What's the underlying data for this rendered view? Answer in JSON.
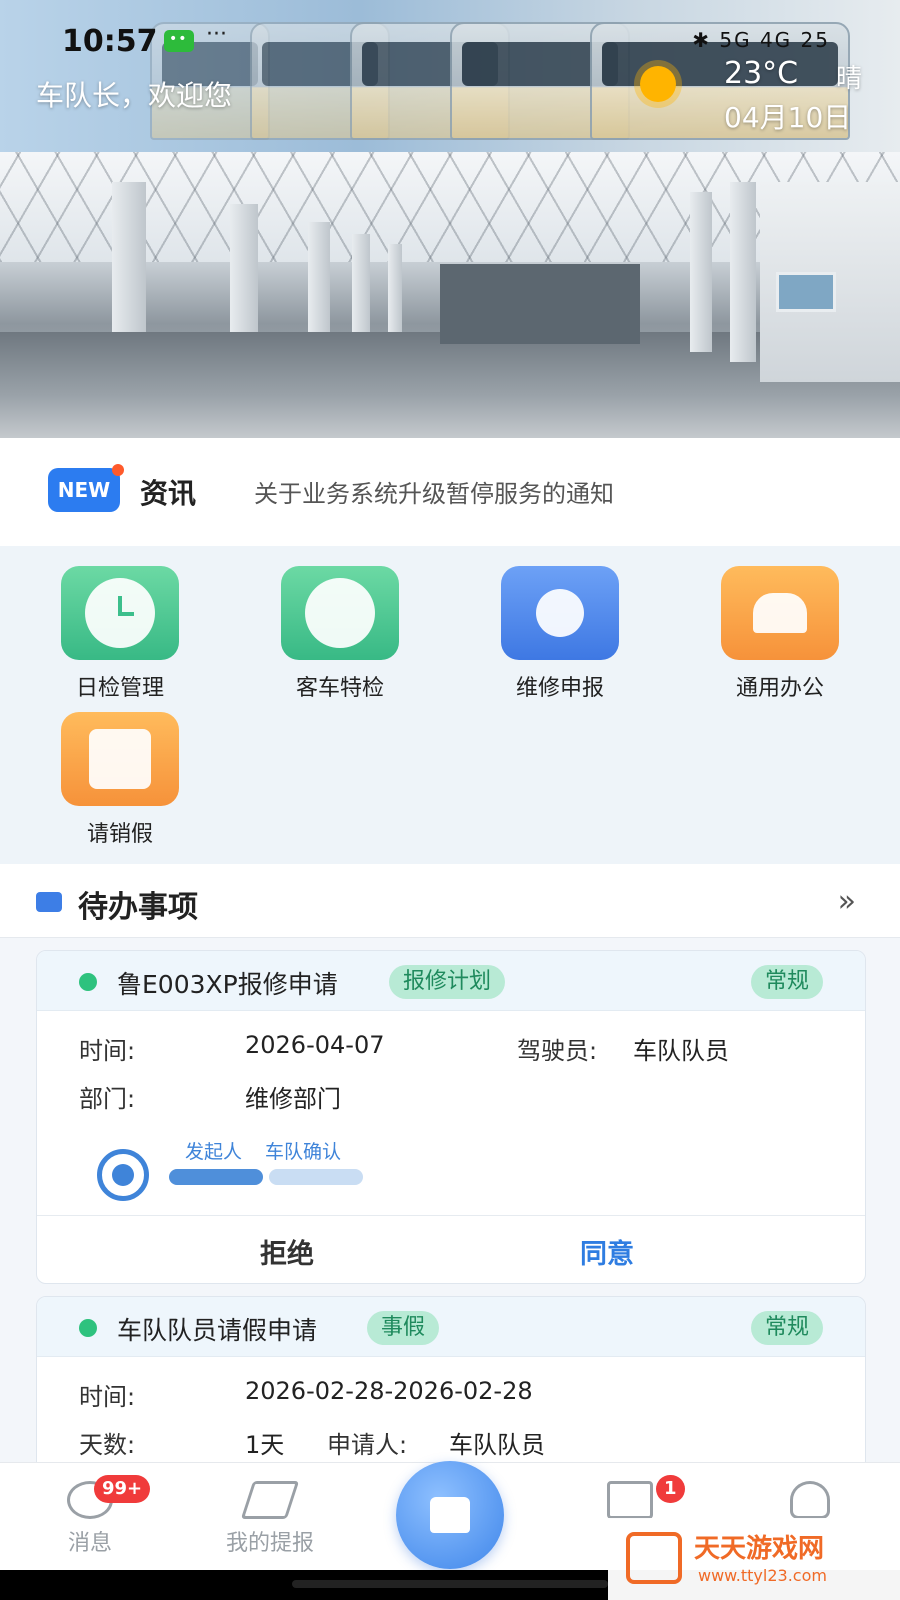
{
  "status_bar": {
    "time": "10:57",
    "more": "···",
    "icons_text": "✱ 5G 4G 25"
  },
  "header": {
    "welcome": "车队长，欢迎您",
    "weather": {
      "temperature": "23°C",
      "condition": "晴",
      "date": "04月10日",
      "icon": "sun-icon"
    }
  },
  "banner": {
    "slides": 3,
    "active_index": 2
  },
  "news": {
    "badge": "NEW",
    "label": "资讯",
    "text": "关于业务系统升级暂停服务的通知"
  },
  "apps": [
    {
      "label": "日检管理",
      "icon": "clock-icon",
      "color": "green"
    },
    {
      "label": "客车特检",
      "icon": "bus-icon",
      "color": "green"
    },
    {
      "label": "维修申报",
      "icon": "wrench-icon",
      "color": "blue"
    },
    {
      "label": "通用办公",
      "icon": "stamp-icon",
      "color": "orange"
    },
    {
      "label": "请销假",
      "icon": "calendar-clock-icon",
      "color": "orange"
    }
  ],
  "todo": {
    "title": "待办事项",
    "more": "»",
    "cards": [
      {
        "title": "鲁E003XP报修申请",
        "tag": "报修计划",
        "priority": "常规",
        "time_label": "时间:",
        "time_value": "2026-04-07",
        "driver_label": "驾驶员:",
        "driver_value": "车队队员",
        "dept_label": "部门:",
        "dept_value": "维修部门",
        "steps": [
          "发起人",
          "车队确认"
        ],
        "reject": "拒绝",
        "approve": "同意"
      },
      {
        "title": "车队队员请假申请",
        "tag": "事假",
        "priority": "常规",
        "time_label": "时间:",
        "time_value": "2026-02-28-2026-02-28",
        "days_label": "天数:",
        "days_value": "1天",
        "applicant_label": "申请人:",
        "applicant_value": "车队队员"
      }
    ]
  },
  "nav": {
    "messages": {
      "label": "消息",
      "badge": "99+"
    },
    "my_reports": {
      "label": "我的提报"
    },
    "files": {
      "badge": "1"
    }
  },
  "watermark": {
    "title": "天天游戏网",
    "url": "www.ttyl23.com"
  }
}
